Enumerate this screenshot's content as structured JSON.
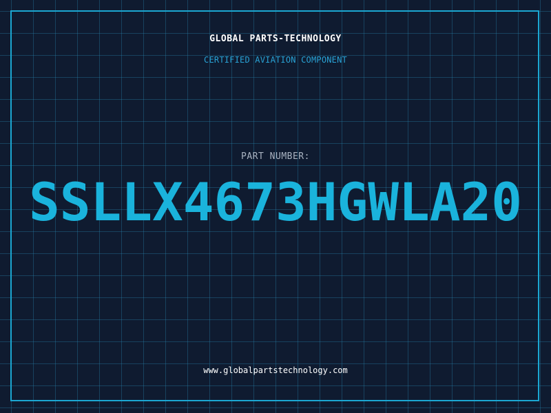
{
  "header": {
    "company_name": "GLOBAL PARTS-TECHNOLOGY",
    "tagline": "CERTIFIED AVIATION COMPONENT"
  },
  "part": {
    "label": "PART NUMBER:",
    "number": "SSLLX4673HGWLA20"
  },
  "footer": {
    "website": "www.globalpartstechnology.com"
  },
  "colors": {
    "background": "#0f1b30",
    "accent": "#1ba7d2",
    "part_number": "#1ab3dc",
    "label": "#aab4c2",
    "text": "#ffffff"
  }
}
